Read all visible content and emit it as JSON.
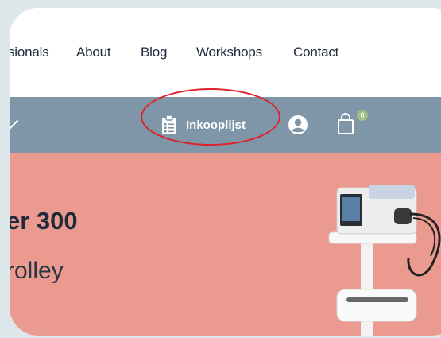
{
  "nav": {
    "items": [
      {
        "label": "sionals"
      },
      {
        "label": "About"
      },
      {
        "label": "Blog"
      },
      {
        "label": "Workshops"
      },
      {
        "label": "Contact"
      }
    ]
  },
  "toolbar": {
    "shopping_list_label": "Inkooplijst",
    "cart_count": "0"
  },
  "hero": {
    "title": "er 300",
    "subtitle": "rolley"
  },
  "colors": {
    "nav_bar": "#7e96a8",
    "hero_bg": "#eb9a90",
    "highlight": "#e0202a",
    "badge": "#9fbf86"
  }
}
